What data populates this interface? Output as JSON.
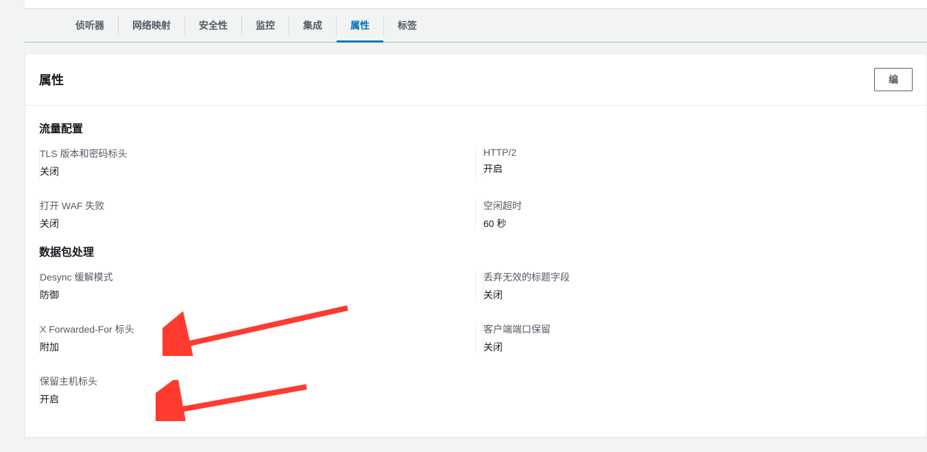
{
  "tabs": {
    "items": [
      {
        "label": "侦听器"
      },
      {
        "label": "网络映射"
      },
      {
        "label": "安全性"
      },
      {
        "label": "监控"
      },
      {
        "label": "集成"
      },
      {
        "label": "属性"
      },
      {
        "label": "标签"
      }
    ],
    "activeIndex": 5
  },
  "panel": {
    "title": "属性",
    "editLabel": "编"
  },
  "sections": {
    "traffic": {
      "title": "流量配置",
      "fields": {
        "tls": {
          "label": "TLS 版本和密码标头",
          "value": "关闭"
        },
        "http2": {
          "label": "HTTP/2",
          "value": "开启"
        },
        "wafFail": {
          "label": "打开 WAF 失败",
          "value": "关闭"
        },
        "idleTimeout": {
          "label": "空闲超时",
          "value": "60 秒"
        }
      }
    },
    "packet": {
      "title": "数据包处理",
      "fields": {
        "desync": {
          "label": "Desync 缓解模式",
          "value": "防御"
        },
        "dropInvalid": {
          "label": "丢弃无效的标题字段",
          "value": "关闭"
        },
        "xff": {
          "label": "X Forwarded-For 标头",
          "value": "附加"
        },
        "clientPort": {
          "label": "客户端端口保留",
          "value": "关闭"
        },
        "preserveHost": {
          "label": "保留主机标头",
          "value": "开启"
        }
      }
    }
  }
}
